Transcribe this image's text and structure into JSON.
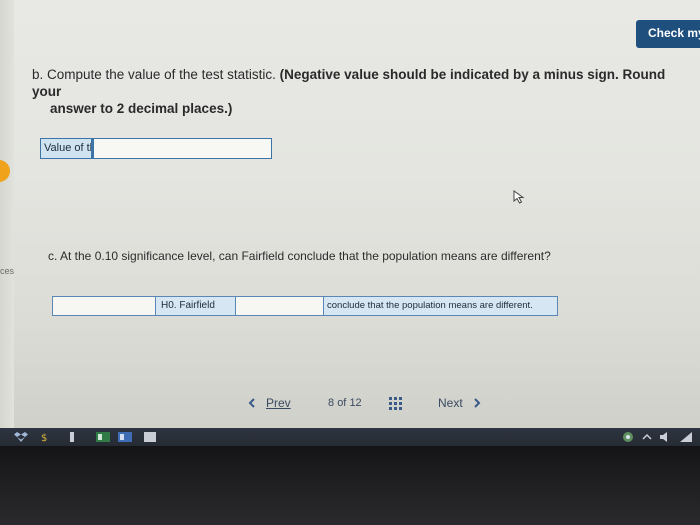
{
  "header": {
    "check_button_label": "Check my"
  },
  "part_b": {
    "lead": "b. Compute the value of the test statistic.",
    "instruction_1": "(Negative value should be indicated by a minus sign. Round your",
    "instruction_2": "answer to 2 decimal places.)",
    "field_label": "Value of the test statistic",
    "field_value": ""
  },
  "part_c": {
    "question": "c. At the 0.10 significance level, can Fairfield conclude that the population means are different?",
    "select_1_value": "",
    "h0_label": "H0. Fairfield",
    "select_2_value": "",
    "conclude_label": "conclude that the population means are different."
  },
  "side": {
    "label": "ces"
  },
  "pagination": {
    "prev_label": "Prev",
    "current_page": "8",
    "of_label": "of",
    "total_pages": "12",
    "next_label": "Next"
  },
  "colors": {
    "check_button_bg": "#1f4f7d",
    "field_border": "#3d74a8",
    "label_bg": "#cfe3f1",
    "orange_tab": "#f0a21a"
  }
}
